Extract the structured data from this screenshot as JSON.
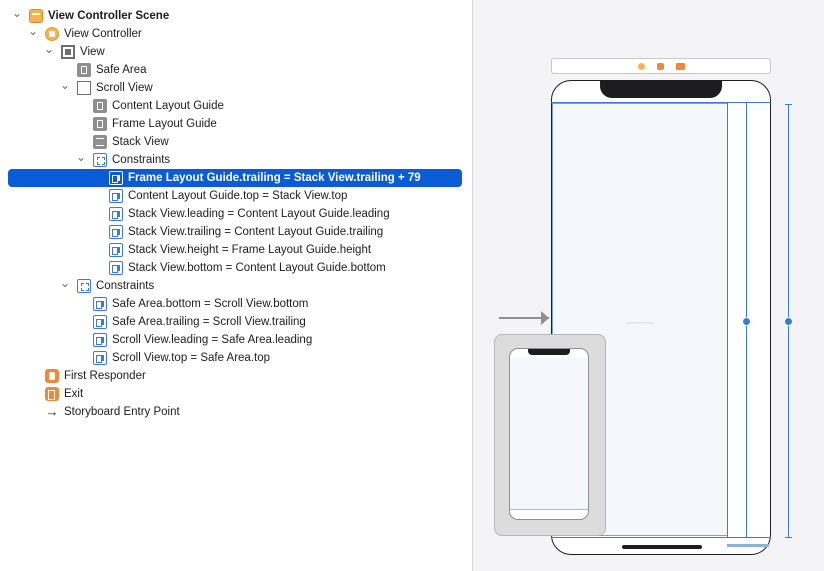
{
  "outline": {
    "rows": [
      {
        "label": "View Controller Scene",
        "icon": "scene-icon",
        "depth": 0,
        "disclosure": "open",
        "bold": true
      },
      {
        "label": "View Controller",
        "icon": "view-controller-icon",
        "depth": 1,
        "disclosure": "open"
      },
      {
        "label": "View",
        "icon": "view-icon",
        "depth": 2,
        "disclosure": "open"
      },
      {
        "label": "Safe Area",
        "icon": "layout-guide-icon",
        "depth": 3,
        "disclosure": "none"
      },
      {
        "label": "Scroll View",
        "icon": "scroll-view-icon",
        "depth": 3,
        "disclosure": "open"
      },
      {
        "label": "Content Layout Guide",
        "icon": "layout-guide-icon",
        "depth": 4,
        "disclosure": "none"
      },
      {
        "label": "Frame Layout Guide",
        "icon": "layout-guide-icon",
        "depth": 4,
        "disclosure": "none"
      },
      {
        "label": "Stack View",
        "icon": "stack-view-icon",
        "depth": 4,
        "disclosure": "none"
      },
      {
        "label": "Constraints",
        "icon": "constraints-group-icon",
        "depth": 4,
        "disclosure": "open"
      },
      {
        "label": "Frame Layout Guide.trailing = Stack View.trailing + 79",
        "icon": "constraint-icon",
        "depth": 5,
        "disclosure": "none",
        "selected": true
      },
      {
        "label": "Content Layout Guide.top = Stack View.top",
        "icon": "constraint-icon",
        "depth": 5,
        "disclosure": "none"
      },
      {
        "label": "Stack View.leading = Content Layout Guide.leading",
        "icon": "constraint-icon",
        "depth": 5,
        "disclosure": "none"
      },
      {
        "label": "Stack View.trailing = Content Layout Guide.trailing",
        "icon": "constraint-icon",
        "depth": 5,
        "disclosure": "none"
      },
      {
        "label": "Stack View.height = Frame Layout Guide.height",
        "icon": "constraint-icon",
        "depth": 5,
        "disclosure": "none"
      },
      {
        "label": "Stack View.bottom = Content Layout Guide.bottom",
        "icon": "constraint-icon",
        "depth": 5,
        "disclosure": "none"
      },
      {
        "label": "Constraints",
        "icon": "constraints-group-icon",
        "depth": 3,
        "disclosure": "open"
      },
      {
        "label": "Safe Area.bottom = Scroll View.bottom",
        "icon": "constraint-icon",
        "depth": 4,
        "disclosure": "none"
      },
      {
        "label": "Safe Area.trailing = Scroll View.trailing",
        "icon": "constraint-icon",
        "depth": 4,
        "disclosure": "none"
      },
      {
        "label": "Scroll View.leading = Safe Area.leading",
        "icon": "constraint-icon",
        "depth": 4,
        "disclosure": "none"
      },
      {
        "label": "Scroll View.top = Safe Area.top",
        "icon": "constraint-icon",
        "depth": 4,
        "disclosure": "none"
      },
      {
        "label": "First Responder",
        "icon": "first-responder-icon",
        "depth": 1,
        "disclosure": "none"
      },
      {
        "label": "Exit",
        "icon": "exit-icon",
        "depth": 1,
        "disclosure": "none"
      },
      {
        "label": "Storyboard Entry Point",
        "icon": "entry-arrow-icon",
        "depth": 1,
        "disclosure": "none"
      }
    ]
  },
  "colors": {
    "selection": "#0a5bd6",
    "constraint": "#3a7bd5",
    "scene_accent": "#f7b44c"
  }
}
